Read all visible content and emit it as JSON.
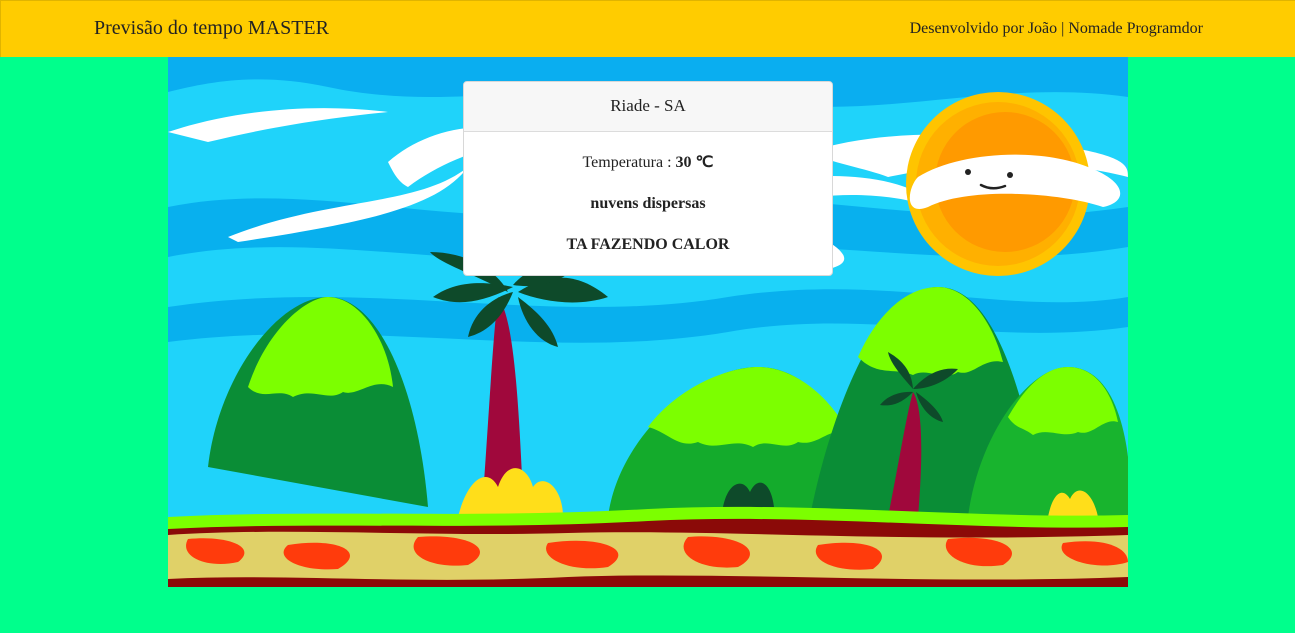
{
  "navbar": {
    "title": "Previsão do tempo MASTER",
    "credits": "Desenvolvido por João | Nomade Programdor"
  },
  "weather": {
    "location": "Riade - SA",
    "temperature_label": "Temperatura :",
    "temperature_value": "30 ℃",
    "description": "nuvens dispersas",
    "message": "TA FAZENDO CALOR"
  },
  "colors": {
    "navbar_bg": "#ffcc00",
    "page_bg": "#00ff8c",
    "sky": "#1fd3fa"
  }
}
